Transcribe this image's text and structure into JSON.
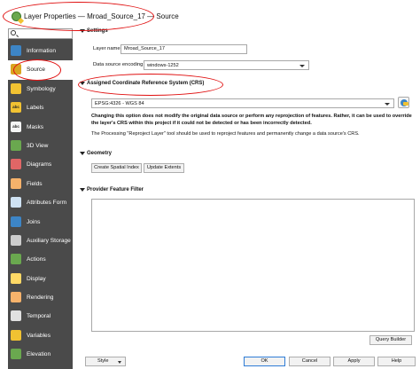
{
  "window": {
    "title": "Layer Properties — Mroad_Source_17 — Source"
  },
  "search": {
    "value": ""
  },
  "sidebar": {
    "items": [
      {
        "label": "Information",
        "icon": "information-icon",
        "color": "#3d85c6"
      },
      {
        "label": "Source",
        "icon": "source-icon",
        "color": "#d9a520"
      },
      {
        "label": "Symbology",
        "icon": "symbology-icon",
        "color": "#f1c232"
      },
      {
        "label": "Labels",
        "icon": "labels-icon",
        "color": "#f1c232"
      },
      {
        "label": "Masks",
        "icon": "masks-icon",
        "color": "#eeeeee"
      },
      {
        "label": "3D View",
        "icon": "3d-view-icon",
        "color": "#6aa84f"
      },
      {
        "label": "Diagrams",
        "icon": "diagrams-icon",
        "color": "#e06666"
      },
      {
        "label": "Fields",
        "icon": "fields-icon",
        "color": "#f6b26b"
      },
      {
        "label": "Attributes Form",
        "icon": "attributes-form-icon",
        "color": "#cfe2f3"
      },
      {
        "label": "Joins",
        "icon": "joins-icon",
        "color": "#3d85c6"
      },
      {
        "label": "Auxiliary Storage",
        "icon": "auxiliary-storage-icon",
        "color": "#cccccc"
      },
      {
        "label": "Actions",
        "icon": "actions-icon",
        "color": "#6aa84f"
      },
      {
        "label": "Display",
        "icon": "display-icon",
        "color": "#ffd966"
      },
      {
        "label": "Rendering",
        "icon": "rendering-icon",
        "color": "#f6b26b"
      },
      {
        "label": "Temporal",
        "icon": "temporal-icon",
        "color": "#e0e0e0"
      },
      {
        "label": "Variables",
        "icon": "variables-icon",
        "color": "#f1c232"
      },
      {
        "label": "Elevation",
        "icon": "elevation-icon",
        "color": "#6aa84f"
      }
    ],
    "labels_icon_text": "abc",
    "masks_icon_text": "abc"
  },
  "settings": {
    "header": "Settings",
    "layer_name_label": "Layer name",
    "layer_name_value": "Mroad_Source_17",
    "encoding_label": "Data source encoding",
    "encoding_value": "windows-1252"
  },
  "crs": {
    "header": "Assigned Coordinate Reference System (CRS)",
    "value": "EPSG:4326 - WGS 84",
    "warning": "Changing this option does not modify the original data source or perform any reprojection of features. Rather, it can be used to override the layer's CRS within this project if it could not be detected or has been incorrectly detected.",
    "note": "The Processing \"Reproject Layer\" tool should be used to reproject features and permanently change a data source's CRS."
  },
  "geometry": {
    "header": "Geometry",
    "spatial_index_label": "Create Spatial Index",
    "update_extents_label": "Update Extents"
  },
  "filter": {
    "header": "Provider Feature Filter",
    "query_builder_label": "Query Builder"
  },
  "footer": {
    "style_label": "Style",
    "ok_label": "OK",
    "cancel_label": "Cancel",
    "apply_label": "Apply",
    "help_label": "Help"
  },
  "colors": {
    "sidebar_bg": "#4a4a4a",
    "annotation_red": "#e01010",
    "accent": "#2f7cd6"
  }
}
